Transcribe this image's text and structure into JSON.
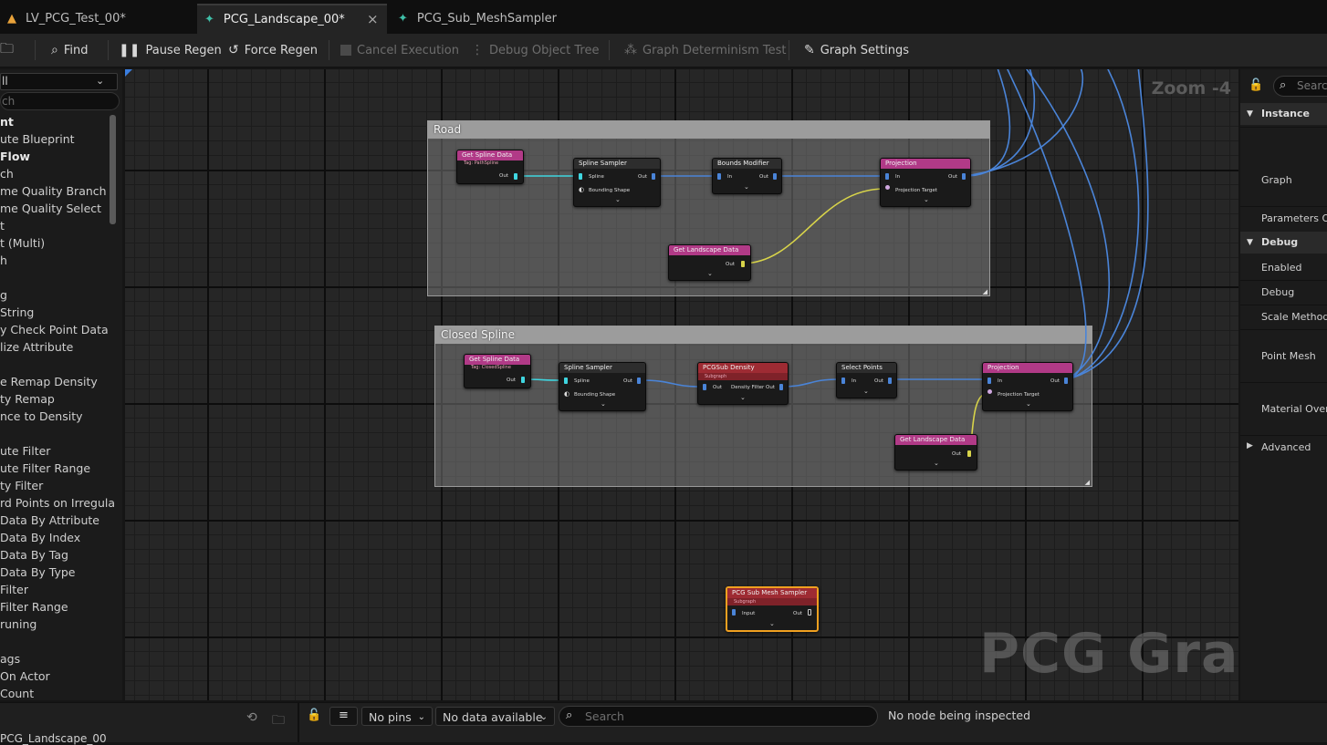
{
  "tabs": [
    {
      "label": "LV_PCG_Test_00*",
      "icon": "level-icon"
    },
    {
      "label": "PCG_Landscape_00*",
      "icon": "pcg-graph-icon",
      "close": "×"
    },
    {
      "label": "PCG_Sub_MeshSampler",
      "icon": "pcg-graph-icon"
    }
  ],
  "toolbar": {
    "find": "Find",
    "pause_regen": "Pause Regen",
    "force_regen": "Force Regen",
    "cancel_execution": "Cancel Execution",
    "debug_object_tree": "Debug Object Tree",
    "graph_determinism_test": "Graph Determinism Test",
    "graph_settings": "Graph Settings"
  },
  "palette": {
    "filter_value": "ll",
    "search_value": "ch",
    "items": [
      {
        "label": "nt",
        "bold": true
      },
      {
        "label": "ute Blueprint"
      },
      {
        "label": " Flow",
        "bold": true
      },
      {
        "label": "ch"
      },
      {
        "label": "me Quality Branch"
      },
      {
        "label": "me Quality Select"
      },
      {
        "label": "t"
      },
      {
        "label": "t (Multi)"
      },
      {
        "label": "h"
      },
      {
        "label": ""
      },
      {
        "label": "g"
      },
      {
        "label": "String"
      },
      {
        "label": "y Check Point Data"
      },
      {
        "label": "lize Attribute"
      },
      {
        "label": ""
      },
      {
        "label": "e Remap Density"
      },
      {
        "label": "ty Remap"
      },
      {
        "label": "nce to Density"
      },
      {
        "label": ""
      },
      {
        "label": "ute Filter"
      },
      {
        "label": "ute Filter Range"
      },
      {
        "label": "ty Filter"
      },
      {
        "label": "rd Points on Irregula"
      },
      {
        "label": " Data By Attribute"
      },
      {
        "label": " Data By Index"
      },
      {
        "label": " Data By Tag"
      },
      {
        "label": " Data By Type"
      },
      {
        "label": " Filter"
      },
      {
        "label": " Filter Range"
      },
      {
        "label": "runing"
      },
      {
        "label": ""
      },
      {
        "label": "ags"
      },
      {
        "label": " On Actor"
      },
      {
        "label": "Count"
      }
    ]
  },
  "graph": {
    "zoom": "Zoom -4",
    "watermark": "PCG Graph",
    "comments": {
      "road": "Road",
      "closed_spline": "Closed Spline"
    },
    "nodes": {
      "road_get_spline": {
        "title": "Get Spline Data",
        "sub": "Tag: PathSpline",
        "out": "Out"
      },
      "road_spline_sampler": {
        "title": "Spline Sampler",
        "in1": "Spline",
        "in2": "Bounding Shape",
        "out": "Out"
      },
      "road_bounds_modifier": {
        "title": "Bounds Modifier",
        "in": "In",
        "out": "Out"
      },
      "road_projection": {
        "title": "Projection",
        "in": "In",
        "in2": "Projection Target",
        "out": "Out"
      },
      "road_get_landscape": {
        "title": "Get Landscape Data",
        "out": "Out"
      },
      "cs_get_spline": {
        "title": "Get Spline Data",
        "sub": "Tag: ClosedSpline",
        "out": "Out"
      },
      "cs_spline_sampler": {
        "title": "Spline Sampler",
        "in1": "Spline",
        "in2": "Bounding Shape",
        "out": "Out"
      },
      "cs_sub_density": {
        "title": "PCGSub Density",
        "sub": "Subgraph",
        "in": "Out",
        "out": "Density Filter Out"
      },
      "cs_select_points": {
        "title": "Select Points",
        "in": "In",
        "out": "Out"
      },
      "cs_projection": {
        "title": "Projection",
        "in": "In",
        "in2": "Projection Target",
        "out": "Out"
      },
      "cs_get_landscape": {
        "title": "Get Landscape Data",
        "out": "Out"
      },
      "sub_mesh_sampler": {
        "title": "PCG Sub Mesh Sampler",
        "sub": "Subgraph",
        "in": "Input",
        "out": "Out"
      }
    }
  },
  "details": {
    "search_placeholder": "Search",
    "sections": {
      "instance": "Instance",
      "debug": "Debug",
      "advanced": "Advanced"
    },
    "rows": {
      "graph": "Graph",
      "parameters": "Parameters Ov",
      "enabled": "Enabled",
      "debug": "Debug",
      "scale_method": "Scale Method",
      "point_mesh": "Point Mesh",
      "material_override": "Material Overr"
    }
  },
  "bottom": {
    "left_label": "PCG_Landscape_00",
    "pins_select": "No pins",
    "data_select": "No data available",
    "search_placeholder": "Search",
    "status": "No node being inspected"
  },
  "colors": {
    "accent_blue": "#4a84d8",
    "wire_cyan": "#3fd6e0",
    "wire_yellow": "#d8d44a",
    "selected_border": "#f0a020",
    "header_pink": "#b13a87",
    "header_red": "#9e2b33",
    "header_dark": "#2d2d2d"
  }
}
